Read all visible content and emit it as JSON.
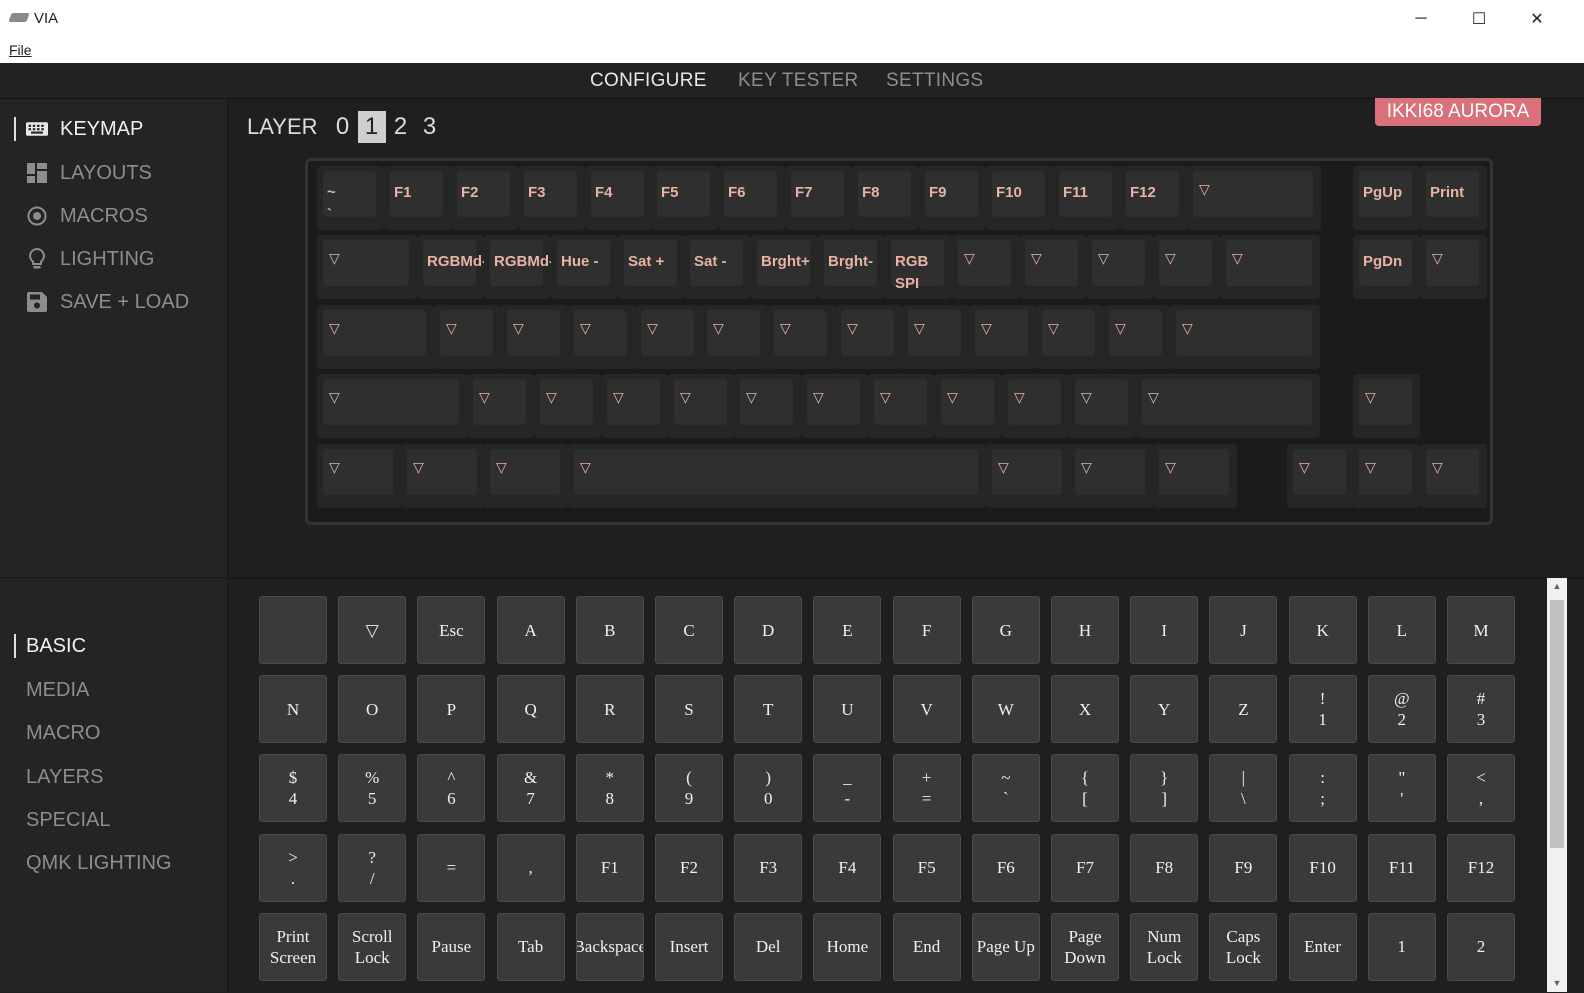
{
  "window": {
    "title": "VIA",
    "minimize": "─",
    "maximize": "☐",
    "close": "✕"
  },
  "menu": {
    "file": "File"
  },
  "topnav": [
    {
      "label": "CONFIGURE",
      "active": true
    },
    {
      "label": "KEY TESTER"
    },
    {
      "label": "SETTINGS"
    }
  ],
  "sidebar": {
    "items": [
      {
        "label": "KEYMAP",
        "icon": "keyboard-icon",
        "active": true
      },
      {
        "label": "LAYOUTS",
        "icon": "grid-icon"
      },
      {
        "label": "MACROS",
        "icon": "circle-dot-icon"
      },
      {
        "label": "LIGHTING",
        "icon": "bulb-icon"
      },
      {
        "label": "SAVE + LOAD",
        "icon": "floppy-icon"
      }
    ]
  },
  "categories": [
    {
      "label": "BASIC",
      "active": true
    },
    {
      "label": "MEDIA"
    },
    {
      "label": "MACRO"
    },
    {
      "label": "LAYERS"
    },
    {
      "label": "SPECIAL"
    },
    {
      "label": "QMK LIGHTING"
    }
  ],
  "layers": {
    "label": "LAYER",
    "items": [
      "0",
      "1",
      "2",
      "3"
    ],
    "active": "1"
  },
  "keyboard_name": "IKKI68 AURORA",
  "colors": {
    "accent": "#d9707a",
    "legend": "#e8b3a3"
  },
  "keyboard_rows": [
    [
      {
        "l": "~\n`"
      },
      {
        "l": "F1"
      },
      {
        "l": "F2"
      },
      {
        "l": "F3"
      },
      {
        "l": "F4"
      },
      {
        "l": "F5"
      },
      {
        "l": "F6"
      },
      {
        "l": "F7"
      },
      {
        "l": "F8"
      },
      {
        "l": "F9"
      },
      {
        "l": "F10"
      },
      {
        "l": "F11"
      },
      {
        "l": "F12"
      },
      {
        "l": "▽"
      },
      {
        "l": "PgUp"
      },
      {
        "l": "Print"
      }
    ],
    [
      {
        "l": "▽"
      },
      {
        "l": "RGBMd-"
      },
      {
        "l": "RGBMd-"
      },
      {
        "l": "Hue -"
      },
      {
        "l": "Sat +"
      },
      {
        "l": "Sat -"
      },
      {
        "l": "Brght+"
      },
      {
        "l": "Brght-"
      },
      {
        "l": "RGB\nSPI"
      },
      {
        "l": "▽"
      },
      {
        "l": "▽"
      },
      {
        "l": "▽"
      },
      {
        "l": "▽"
      },
      {
        "l": "▽"
      },
      {
        "l": "PgDn"
      },
      {
        "l": "▽"
      }
    ],
    [
      {
        "l": "▽"
      },
      {
        "l": "▽"
      },
      {
        "l": "▽"
      },
      {
        "l": "▽"
      },
      {
        "l": "▽"
      },
      {
        "l": "▽"
      },
      {
        "l": "▽"
      },
      {
        "l": "▽"
      },
      {
        "l": "▽"
      },
      {
        "l": "▽"
      },
      {
        "l": "▽"
      },
      {
        "l": "▽"
      },
      {
        "l": "▽"
      }
    ],
    [
      {
        "l": "▽"
      },
      {
        "l": "▽"
      },
      {
        "l": "▽"
      },
      {
        "l": "▽"
      },
      {
        "l": "▽"
      },
      {
        "l": "▽"
      },
      {
        "l": "▽"
      },
      {
        "l": "▽"
      },
      {
        "l": "▽"
      },
      {
        "l": "▽"
      },
      {
        "l": "▽"
      },
      {
        "l": "▽"
      },
      {
        "l": "▽"
      }
    ],
    [
      {
        "l": "▽"
      },
      {
        "l": "▽"
      },
      {
        "l": "▽"
      },
      {
        "l": "▽"
      },
      {
        "l": "▽"
      },
      {
        "l": "▽"
      },
      {
        "l": "▽"
      },
      {
        "l": "▽"
      },
      {
        "l": "▽"
      },
      {
        "l": "▽"
      }
    ]
  ],
  "basic_keys": [
    "",
    "▽",
    "Esc",
    "A",
    "B",
    "C",
    "D",
    "E",
    "F",
    "G",
    "H",
    "I",
    "J",
    "K",
    "L",
    "M",
    "N",
    "O",
    "P",
    "Q",
    "R",
    "S",
    "T",
    "U",
    "V",
    "W",
    "X",
    "Y",
    "Z",
    "!\n1",
    "@\n2",
    "#\n3",
    "$\n4",
    "%\n5",
    "^\n6",
    "&\n7",
    "*\n8",
    "(\n9",
    ")\n0",
    "_\n-",
    "+\n=",
    "~\n`",
    "{\n[",
    "}\n]",
    "|\n\\",
    ":\n;",
    "\"\n'",
    "<\n,",
    ">\n.",
    "?\n/",
    "=",
    ",",
    "F1",
    "F2",
    "F3",
    "F4",
    "F5",
    "F6",
    "F7",
    "F8",
    "F9",
    "F10",
    "F11",
    "F12",
    "Print\nScreen",
    "Scroll\nLock",
    "Pause",
    "Tab",
    "Backspace",
    "Insert",
    "Del",
    "Home",
    "End",
    "Page Up",
    "Page\nDown",
    "Num\nLock",
    "Caps\nLock",
    "Enter",
    "1",
    "2"
  ]
}
